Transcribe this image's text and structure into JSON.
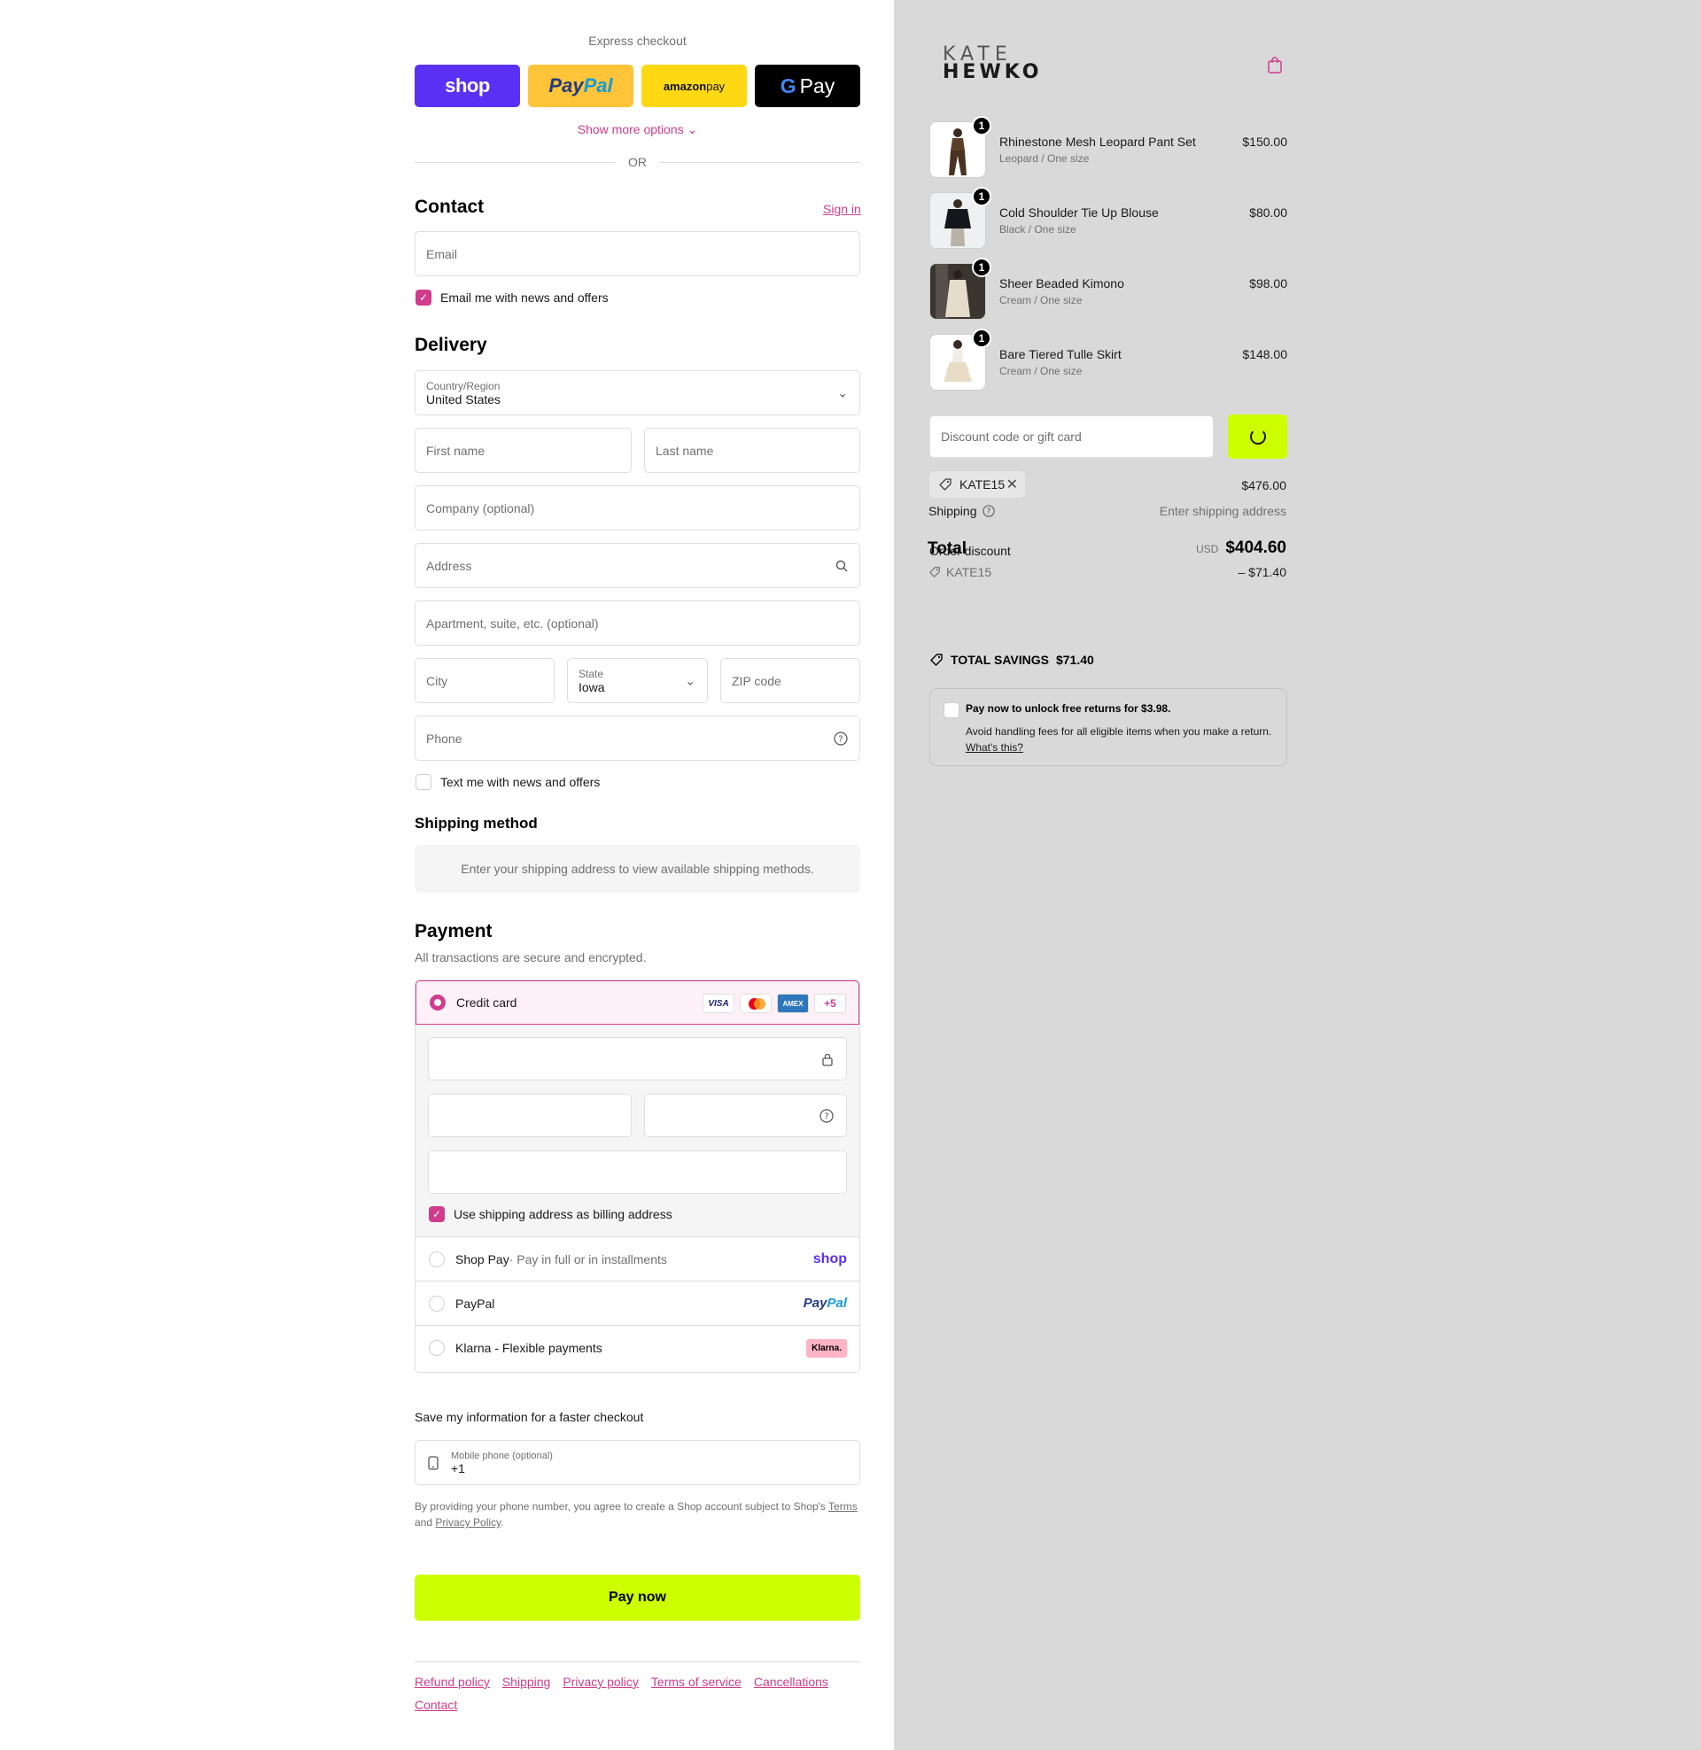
{
  "express": {
    "title": "Express checkout",
    "shop_label": "shop",
    "paypal_label_1": "Pay",
    "paypal_label_2": "Pal",
    "amazon_label_1": "amazon",
    "amazon_label_2": " pay",
    "gpay_g": "G",
    "gpay_label": "Pay",
    "show_more": "Show more options",
    "or": "OR"
  },
  "contact": {
    "title": "Contact",
    "sign_in": "Sign in",
    "email_placeholder": "Email",
    "news_checkbox": "Email me with news and offers",
    "news_checked": true
  },
  "delivery": {
    "title": "Delivery",
    "country_label": "Country/Region",
    "country_value": "United States",
    "first_name": "First name",
    "last_name": "Last name",
    "company": "Company (optional)",
    "address": "Address",
    "apartment": "Apartment, suite, etc. (optional)",
    "city": "City",
    "state_label": "State",
    "state_value": "Iowa",
    "zip": "ZIP code",
    "phone": "Phone",
    "sms_checkbox": "Text me with news and offers",
    "sms_checked": false
  },
  "shipping_method": {
    "title": "Shipping method",
    "message": "Enter your shipping address to view available shipping methods."
  },
  "payment": {
    "title": "Payment",
    "subtitle": "All transactions are secure and encrypted.",
    "credit_card": "Credit card",
    "card_badges": [
      "VISA",
      "",
      "AMEX",
      "+5"
    ],
    "billing_checkbox": "Use shipping address as billing address",
    "billing_checked": true,
    "shop_pay": "Shop Pay",
    "shop_pay_sub": " · Pay in full or in installments",
    "shop_logo": "shop",
    "paypal": "PayPal",
    "paypal_logo_1": "Pay",
    "paypal_logo_2": "Pal",
    "klarna": "Klarna - Flexible payments",
    "klarna_logo": "Klarna."
  },
  "save_info": {
    "title": "Save my information for a faster checkout",
    "phone_label": "Mobile phone (optional)",
    "phone_value": "+1",
    "disclaimer_1": "By providing your phone number, you agree to create a Shop account subject to Shop's ",
    "terms": "Terms",
    "disclaimer_2": " and ",
    "privacy": "Privacy Policy",
    "disclaimer_3": "."
  },
  "pay_now": "Pay now",
  "footer": [
    "Refund policy",
    "Shipping",
    "Privacy policy",
    "Terms of service",
    "Cancellations",
    "Contact"
  ],
  "brand": {
    "line1": "KATE",
    "line2": "HEWKO"
  },
  "cart": {
    "items": [
      {
        "name": "Rhinestone Mesh Leopard Pant Set",
        "variant": "Leopard / One size",
        "price": "$150.00",
        "qty": "1"
      },
      {
        "name": "Cold Shoulder Tie Up Blouse",
        "variant": "Black / One size",
        "price": "$80.00",
        "qty": "1"
      },
      {
        "name": "Sheer Beaded Kimono",
        "variant": "Cream / One size",
        "price": "$98.00",
        "qty": "1"
      },
      {
        "name": "Bare Tiered Tulle Skirt",
        "variant": "Cream / One size",
        "price": "$148.00",
        "qty": "1"
      }
    ],
    "discount_placeholder": "Discount code or gift card",
    "applied_code": "KATE15",
    "subtotal": "$476.00",
    "shipping_label": "Shipping",
    "shipping_value": "Enter shipping address",
    "total_label": "Total",
    "order_discount_label": "Order discount",
    "total_currency": "USD",
    "total_amount": "$404.60",
    "discount_code": "KATE15",
    "discount_amount": "– $71.40",
    "savings_label": "TOTAL SAVINGS",
    "savings_amount": "$71.40",
    "returns_title": "Pay now to unlock free returns for $3.98.",
    "returns_desc": "Avoid handling fees for all eligible items when you make a return.",
    "returns_link": "What's this?"
  },
  "colors": {
    "accent": "#d13c8c",
    "cta": "#ccff00",
    "sidebar_bg": "#d9d9d9"
  }
}
